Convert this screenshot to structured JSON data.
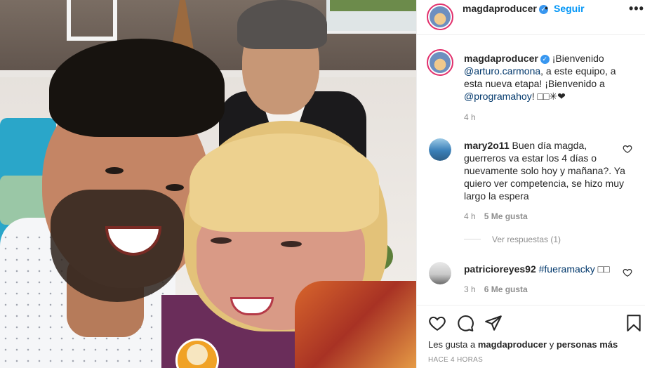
{
  "post": {
    "author": "magdaproducer",
    "verified_mark": "✓",
    "dot": "•",
    "follow_label": "Seguir",
    "more_label": "•••",
    "icons": [
      "verified-badge-icon",
      "more-options-icon"
    ]
  },
  "caption": {
    "author": "magdaproducer",
    "text_part1": "¡Bienvenido ",
    "mention1": "@arturo.carmona",
    "text_part2": ", a este equipo, a esta nueva etapa! ¡Bienvenido a ",
    "mention2": "@programahoy",
    "text_part3": "! ",
    "emoji": "□□✳❤",
    "time": "4 h"
  },
  "comments": [
    {
      "author": "mary2o11",
      "text": "Buen día magda, guerreros va estar los 4 días o nuevamente solo hoy y mañana?. Ya quiero ver competencia, se hizo muy largo la espera",
      "time": "4 h",
      "likes": "5 Me gusta",
      "replies": "Ver respuestas (1)"
    },
    {
      "author": "patricioreyes92",
      "hashtag": "#fueramacky",
      "emoji": " □□",
      "time": "3 h",
      "likes": "6 Me gusta"
    }
  ],
  "footer": {
    "likes_prefix": "Les gusta a ",
    "likes_user": "magdaproducer",
    "likes_suffix": " y ",
    "likes_more": "personas más",
    "ago": "HACE 4 HORAS",
    "icons": [
      "heart-icon",
      "comment-icon",
      "share-icon",
      "bookmark-icon"
    ]
  }
}
